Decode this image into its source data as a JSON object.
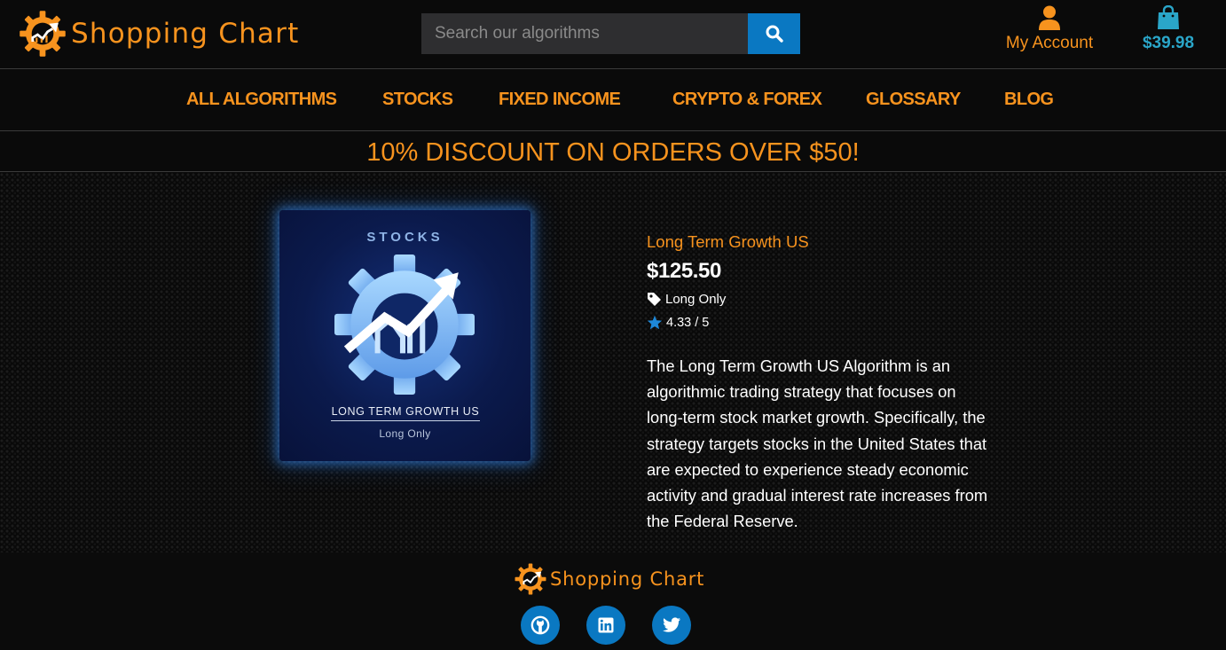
{
  "brand": {
    "name": "Shopping Chart"
  },
  "search": {
    "placeholder": "Search our algorithms"
  },
  "account": {
    "label": "My Account"
  },
  "cart": {
    "total": "$39.98"
  },
  "nav": {
    "items": [
      {
        "label": "ALL ALGORITHMS"
      },
      {
        "label": "STOCKS"
      },
      {
        "label": "FIXED INCOME"
      },
      {
        "label": "CRYPTO & FOREX"
      },
      {
        "label": "GLOSSARY"
      },
      {
        "label": "BLOG"
      }
    ]
  },
  "banner": {
    "text": "10% DISCOUNT ON ORDERS OVER $50!"
  },
  "product": {
    "card": {
      "category": "STOCKS",
      "title": "LONG TERM GROWTH US",
      "subtitle": "Long Only"
    },
    "name": "Long Term Growth US",
    "price": "$125.50",
    "tag": "Long Only",
    "rating": "4.33 / 5",
    "description": "The Long Term Growth US Algorithm is an algorithmic trading strategy that focuses on long-term stock market growth. Specifically, the strategy targets stocks in the United States that are expected to experience steady economic activity and gradual interest rate increases from the Federal Reserve."
  },
  "footer": {
    "brand": "Shopping Chart"
  },
  "icons": {
    "search": "search-icon",
    "user": "user-icon",
    "bag": "shopping-bag-icon",
    "tag": "tag-icon",
    "star": "star-icon",
    "github": "github-icon",
    "linkedin": "linkedin-icon",
    "twitter": "twitter-icon"
  },
  "colors": {
    "accent": "#f7931e",
    "blue": "#0a78c2",
    "cart": "#2aa6c9",
    "background": "#0b0b0b"
  }
}
